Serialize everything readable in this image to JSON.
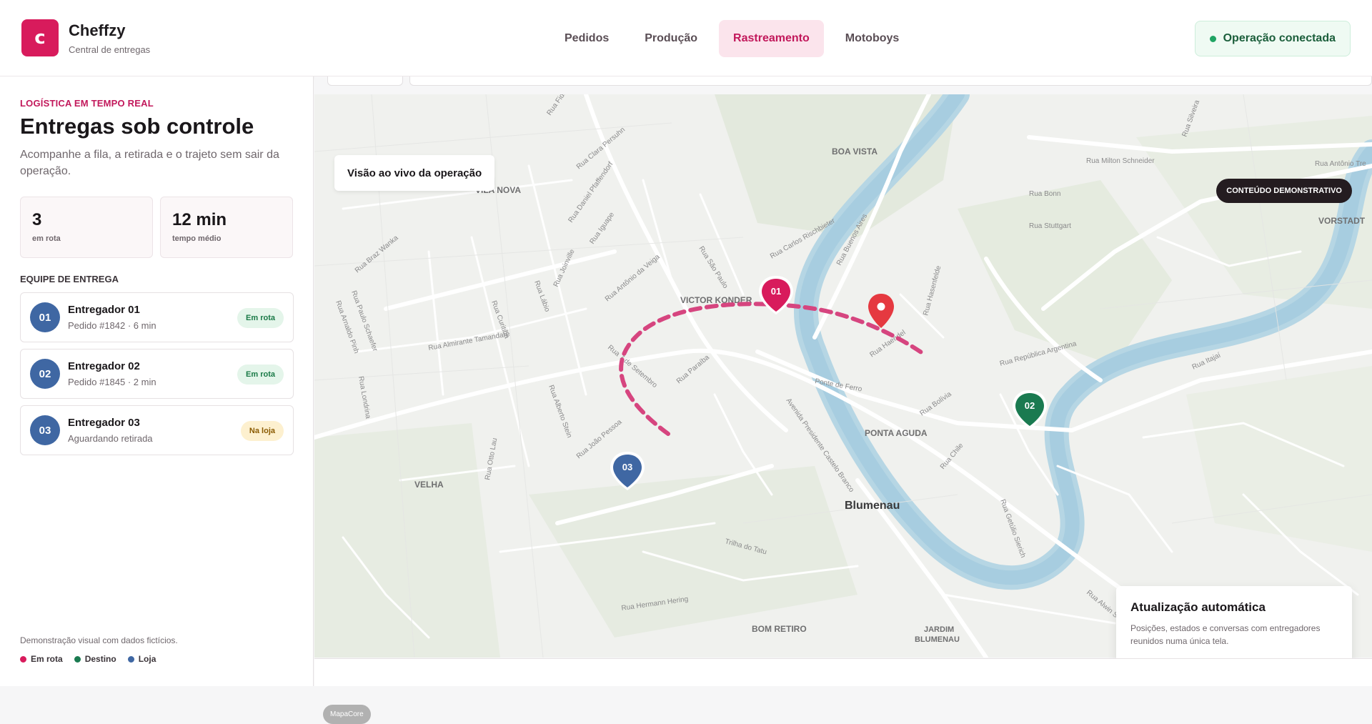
{
  "brand": {
    "logo_letter": "c",
    "name": "Cheffzy",
    "subtitle": "Central de entregas"
  },
  "nav": {
    "items": [
      {
        "label": "Pedidos",
        "active": false
      },
      {
        "label": "Produção",
        "active": false
      },
      {
        "label": "Rastreamento",
        "active": true
      },
      {
        "label": "Motoboys",
        "active": false
      }
    ]
  },
  "status": {
    "label": "Operação conectada"
  },
  "sidebar": {
    "eyebrow": "LOGÍSTICA EM TEMPO REAL",
    "title": "Entregas sob controle",
    "description": "Acompanhe a fila, a retirada e o trajeto sem sair da operação.",
    "stats": [
      {
        "value": "3",
        "label": "em rota"
      },
      {
        "value": "12 min",
        "label": "tempo médio"
      }
    ],
    "section_label": "EQUIPE DE ENTREGA",
    "team": [
      {
        "number": "01",
        "name": "Entregador 01",
        "detail": "Pedido #1842 · 6 min",
        "badge": "Em rota",
        "badge_type": "green"
      },
      {
        "number": "02",
        "name": "Entregador 02",
        "detail": "Pedido #1845 · 2 min",
        "badge": "Em rota",
        "badge_type": "green"
      },
      {
        "number": "03",
        "name": "Entregador 03",
        "detail": "Aguardando retirada",
        "badge": "Na loja",
        "badge_type": "yellow"
      }
    ],
    "footnote": "Demonstração visual com dados fictícios.",
    "legend": [
      {
        "label": "Em rota",
        "color": "#d81b5c"
      },
      {
        "label": "Destino",
        "color": "#1a7a50"
      },
      {
        "label": "Loja",
        "color": "#3f67a3"
      }
    ]
  },
  "map": {
    "title": "Visão ao vivo da operação",
    "demo_label": "CONTEÚDO DEMONSTRATIVO",
    "attribution": "MapaCore",
    "markers": [
      {
        "label": "01",
        "color": "#d81b5c"
      },
      {
        "label": "02",
        "color": "#1a7a50"
      },
      {
        "label": "03",
        "color": "#3f67a3"
      }
    ],
    "destination_color": "#e53940",
    "route_color": "#d6457f",
    "places": {
      "boa_vista": "BOA VISTA",
      "vila_nova": "VILA NOVA",
      "vorstadt": "VORSTADT",
      "victor_konder": "VICTOR KONDER",
      "ponta_aguda": "PONTA AGUDA",
      "velha": "VELHA",
      "blumenau": "Blumenau",
      "bom_retiro": "BOM RETIRO",
      "jardim_blumenau_1": "JARDIM",
      "jardim_blumenau_2": "BLUMENAU"
    },
    "streets": {
      "s1": "Rua Milton Schneider",
      "s2": "Rua Bonn",
      "s3": "Rua Stuttgart",
      "s4": "Rua Antônio Tre",
      "s5": "Rua Silveira",
      "s6": "Rua Carlos Rischbieter",
      "s7": "Rua Buenos Aires",
      "s8": "Rua São Paulo",
      "s9": "Rua Antônio da Veiga",
      "s10": "Rua Clara Persuhn",
      "s11": "Rua Daniel Pfaffendorf",
      "s12": "Rua Iguape",
      "s13": "Rua Joinville",
      "s14": "Rua Lábio",
      "s15": "Rua Curitiba",
      "s16": "Rua Braz Wanka",
      "s17": "Rua Paulo Schaefer",
      "s18": "Rua Almirante Tamandaré",
      "s19": "Rua 7 de Setembro",
      "s20": "Rua Londrina",
      "s21": "Rua Alberto Stein",
      "s22": "Rua João Pessoa",
      "s23": "Rua Otto Lau",
      "s24": "Rua Paraíba",
      "s25": "Avenida Presidente Castelo Branco",
      "s26": "Ponte de Ferro",
      "s27": "Rua Bolívia",
      "s28": "Rua República Argentina",
      "s29": "Rua Itajaí",
      "s30": "Rua Getúlio Sierich",
      "s31": "Rua Chile",
      "s32": "Trilha do Tatu",
      "s33": "Rua Hermann Hering",
      "s34": "Rua Alwin Schrader",
      "s35": "Rua Haendel",
      "s36": "Rua Hasenfelde",
      "s37": "Rua Fidel",
      "s38": "Rua Arnaldo Pinh"
    },
    "update_card": {
      "title": "Atualização automática",
      "description": "Posições, estados e conversas com entregadores reunidos numa única tela."
    }
  }
}
